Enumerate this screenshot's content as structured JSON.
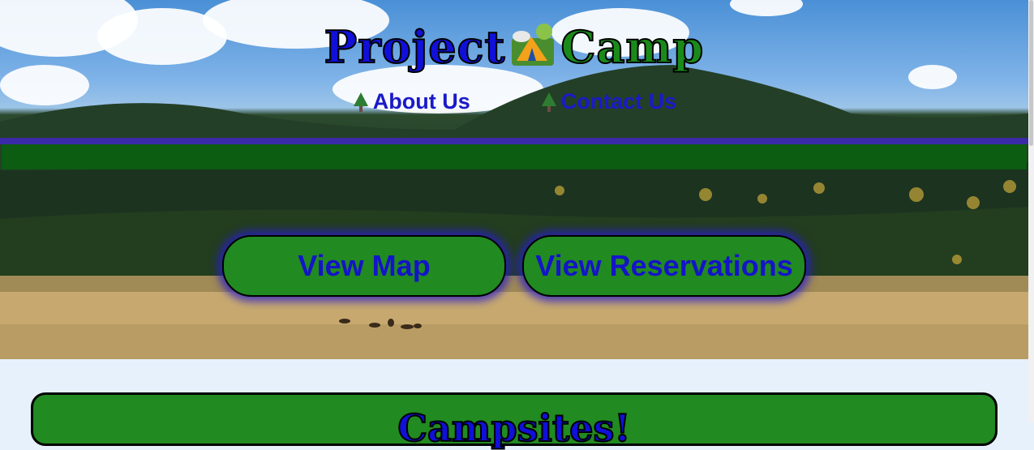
{
  "header": {
    "title_part1": "Project",
    "title_icon": "camping-tent-icon",
    "title_part2": "Camp"
  },
  "nav": [
    {
      "icon": "evergreen-tree-icon",
      "label": "About Us"
    },
    {
      "icon": "evergreen-tree-icon",
      "label": "Contact Us"
    }
  ],
  "actions": {
    "view_map": "View Map",
    "view_reservations": "View Reservations"
  },
  "section": {
    "title": "Campsites!"
  },
  "colors": {
    "brand_blue": "#1414c8",
    "brand_green": "#218a21",
    "band_green": "#0c5c12",
    "band_purple": "#3a2aa8"
  }
}
